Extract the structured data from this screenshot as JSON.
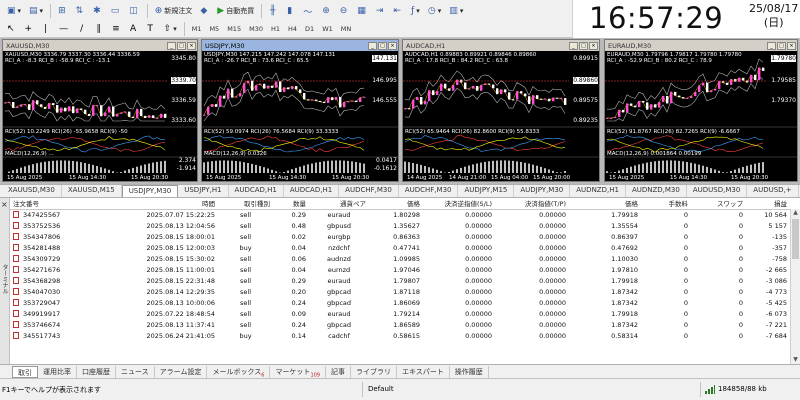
{
  "toolbar": {
    "new_order": "新規注文",
    "auto_trading": "自動売買",
    "timeframes": [
      "M1",
      "M5",
      "M15",
      "M30",
      "H1",
      "H4",
      "D1",
      "W1",
      "MN"
    ]
  },
  "clock": {
    "time": "16:57:29",
    "date": "25/08/17",
    "weekday": "(日)"
  },
  "charts": [
    {
      "title": "XAUUSD,M30",
      "info": "XAUUSD,M30  3336.79 3337.30 3336.44 3336.59",
      "rci": "RCI_A : -8.3  RCI_B : -58.9  RCI_C : -13.1",
      "rci2": "RCI(52) 10.2249  RCI(26) -55.9658  RCI(9) -50",
      "macd": "MACD(12,26,9) ...",
      "prices": [
        "3345.80",
        "3339.70",
        "3336.59",
        "3333.60"
      ],
      "sub_prices": [
        "2.374",
        "-1.914"
      ],
      "dates": [
        "15 Aug 2025",
        "15 Aug 14:30",
        "15 Aug 20:30"
      ],
      "active": false
    },
    {
      "title": "USDJPY,M30",
      "info": "USDJPY,M30  147.215 147.242 147.078 147.131",
      "rci": "RCI_A : -26.7  RCI_B : 73.6  RCI_C : 65.5",
      "rci2": "RCI(52) 59.0974  RCI(26) 76.5684  RCI(9) 33.3333",
      "macd": "MACD(12,26,9) 0.0326",
      "prices": [
        "147.131",
        "146.995",
        "146.555"
      ],
      "sub_prices": [
        "0.0417",
        "-0.1612"
      ],
      "dates": [
        "15 Aug 2025",
        "15 Aug 14:30",
        "15 Aug 20:30"
      ],
      "active": true
    },
    {
      "title": "AUDCAD,H1",
      "info": "AUDCAD,H1  0.89883 0.89921 0.89846 0.89860",
      "rci": "RCI_A : 17.8  RCI_B : 84.2  RCI_C : 63.8",
      "rci2": "RCI(52) 65.9464  RCI(26) 82.8600  RCI(9) 55.8333",
      "macd": "",
      "prices": [
        "0.89915",
        "0.89860",
        "0.89575",
        "0.89235"
      ],
      "sub_prices": [],
      "dates": [
        "14 Aug 2025",
        "14 Aug 21:00",
        "15 Aug 04:00",
        "15 Aug 20:00"
      ],
      "active": false
    },
    {
      "title": "EURAUD,M30",
      "info": "EURAUD,M30  1.79796 1.79817 1.79780 1.79780",
      "rci": "RCI_A : -52.9  RCI_B : 80.2  RCI_C : 78.9",
      "rci2": "RCI(52) 91.8767  RCI(26) 82.7265  RCI(9) -6.6667",
      "macd": "MACD(12,26,9) 0.001864 0.00199",
      "prices": [
        "1.79780",
        "1.79585",
        "1.79370"
      ],
      "sub_prices": [],
      "dates": [
        "15 Aug 2025",
        "15 Aug 14:30",
        "15 Aug 20:30"
      ],
      "active": false
    }
  ],
  "symbol_tabs": [
    "XAUUSD,M30",
    "XAUUSD,M15",
    "USDJPY,M30",
    "USDJPY,H1",
    "AUDCAD,H1",
    "AUDCAD,H1",
    "AUDCHF,M30",
    "AUDCHF,M30",
    "AUDJPY,M15",
    "AUDJPY,M30",
    "AUDNZD,H1",
    "AUDNZD,M30",
    "AUDUSD,M30",
    "AUDUSD,+"
  ],
  "active_symbol_tab": 2,
  "table": {
    "headers": [
      "注文番号",
      "時間",
      "取引種別",
      "数量",
      "通貨ペア",
      "価格",
      "決済逆指値(S/L)",
      "決済指値(T/P)",
      "価格",
      "手数料",
      "スワップ",
      "損益"
    ],
    "rows": [
      [
        "347425567",
        "2025.07.07 15:22:25",
        "sell",
        "0.29",
        "euraud",
        "1.80298",
        "0.00000",
        "0.00000",
        "1.79918",
        "0",
        "0",
        "10 564"
      ],
      [
        "353752536",
        "2025.08.13 12:04:56",
        "sell",
        "0.48",
        "gbpusd",
        "1.35627",
        "0.00000",
        "0.00000",
        "1.35554",
        "0",
        "0",
        "5 157"
      ],
      [
        "354347806",
        "2025.08.15 18:00:01",
        "sell",
        "0.02",
        "eurgbp",
        "0.86363",
        "0.00000",
        "0.00000",
        "0.86397",
        "0",
        "0",
        "-135"
      ],
      [
        "354281488",
        "2025.08.15 12:00:03",
        "buy",
        "0.04",
        "nzdchf",
        "0.47741",
        "0.00000",
        "0.00000",
        "0.47692",
        "0",
        "0",
        "-357"
      ],
      [
        "354309729",
        "2025.08.15 15:30:02",
        "sell",
        "0.06",
        "audnzd",
        "1.09985",
        "0.00000",
        "0.00000",
        "1.10030",
        "0",
        "0",
        "-758"
      ],
      [
        "354271676",
        "2025.08.15 11:00:01",
        "sell",
        "0.04",
        "eurnzd",
        "1.97046",
        "0.00000",
        "0.00000",
        "1.97810",
        "0",
        "0",
        "-2 665"
      ],
      [
        "354368298",
        "2025.08.15 22:31:48",
        "sell",
        "0.29",
        "euraud",
        "1.79807",
        "0.00000",
        "0.00000",
        "1.79918",
        "0",
        "0",
        "-3 086"
      ],
      [
        "354047030",
        "2025.08.14 12:29:35",
        "sell",
        "0.20",
        "gbpcad",
        "1.87118",
        "0.00000",
        "0.00000",
        "1.87342",
        "0",
        "0",
        "-4 773"
      ],
      [
        "353729047",
        "2025.08.13 10:00:06",
        "sell",
        "0.24",
        "gbpcad",
        "1.86069",
        "0.00000",
        "0.00000",
        "1.87342",
        "0",
        "0",
        "-5 425"
      ],
      [
        "349919917",
        "2025.07.22 18:48:54",
        "sell",
        "0.09",
        "euraud",
        "1.79214",
        "0.00000",
        "0.00000",
        "1.79918",
        "0",
        "0",
        "-6 073"
      ],
      [
        "353746674",
        "2025.08.13 11:37:41",
        "sell",
        "0.24",
        "gbpcad",
        "1.86589",
        "0.00000",
        "0.00000",
        "1.87342",
        "0",
        "0",
        "-7 221"
      ],
      [
        "345517743",
        "2025.06.24 21:41:05",
        "buy",
        "0.14",
        "cadchf",
        "0.58615",
        "0.00000",
        "0.00000",
        "0.58314",
        "0",
        "0",
        "-7 684"
      ]
    ]
  },
  "terminal_strip_label": "ターミナル",
  "bottom_tabs": [
    {
      "label": "取引",
      "badge": ""
    },
    {
      "label": "運用比率",
      "badge": ""
    },
    {
      "label": "口座履歴",
      "badge": ""
    },
    {
      "label": "ニュース",
      "badge": ""
    },
    {
      "label": "アラーム設定",
      "badge": ""
    },
    {
      "label": "メールボックス",
      "badge": "6"
    },
    {
      "label": "マーケット",
      "badge": "109"
    },
    {
      "label": "記事",
      "badge": ""
    },
    {
      "label": "ライブラリ",
      "badge": ""
    },
    {
      "label": "エキスパート",
      "badge": ""
    },
    {
      "label": "操作履歴",
      "badge": ""
    }
  ],
  "status": {
    "help": "F1キーでヘルプが表示されます",
    "profile": "Default",
    "traffic": "184858/88 kb"
  }
}
